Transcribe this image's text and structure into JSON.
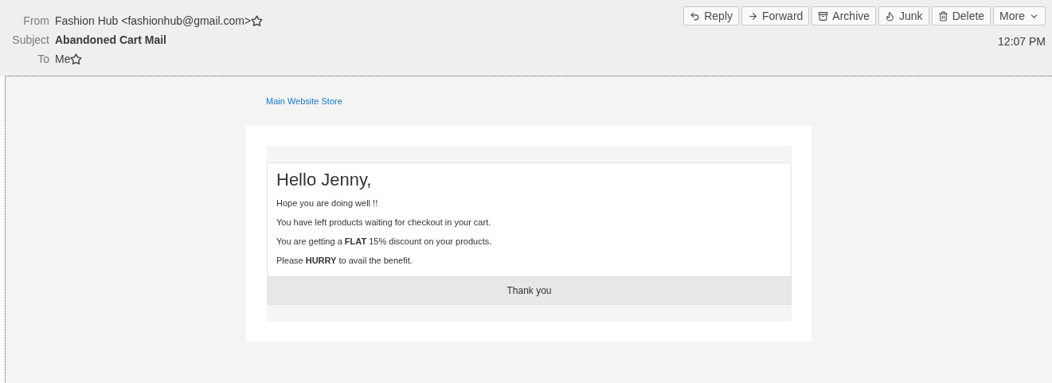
{
  "header": {
    "fields": [
      {
        "label": "From",
        "value": "Fashion Hub <fashionhub@gmail.com>",
        "bold": false,
        "starred": false
      },
      {
        "label": "Subject",
        "value": "Abandoned Cart Mail",
        "bold": true
      },
      {
        "label": "To",
        "value": "Me",
        "bold": false,
        "starred": false
      }
    ],
    "buttons": [
      {
        "kind": "reply",
        "label": "Reply"
      },
      {
        "kind": "forward",
        "label": "Forward"
      },
      {
        "kind": "archive",
        "label": "Archive"
      },
      {
        "kind": "junk",
        "label": "Junk"
      },
      {
        "kind": "delete",
        "label": "Delete"
      },
      {
        "kind": "more",
        "label": "More"
      }
    ],
    "time": "12:07 PM"
  },
  "message": {
    "store_link": "Main Website Store",
    "greeting": "Hello Jenny,",
    "paragraphs": [
      "Hope you are doing well !!",
      "You have left products waiting for checkout in your cart.",
      "You are getting a **FLAT** 15% discount on your products.",
      "Please **HURRY** to avail the benefit."
    ],
    "footer": "Thank you"
  }
}
